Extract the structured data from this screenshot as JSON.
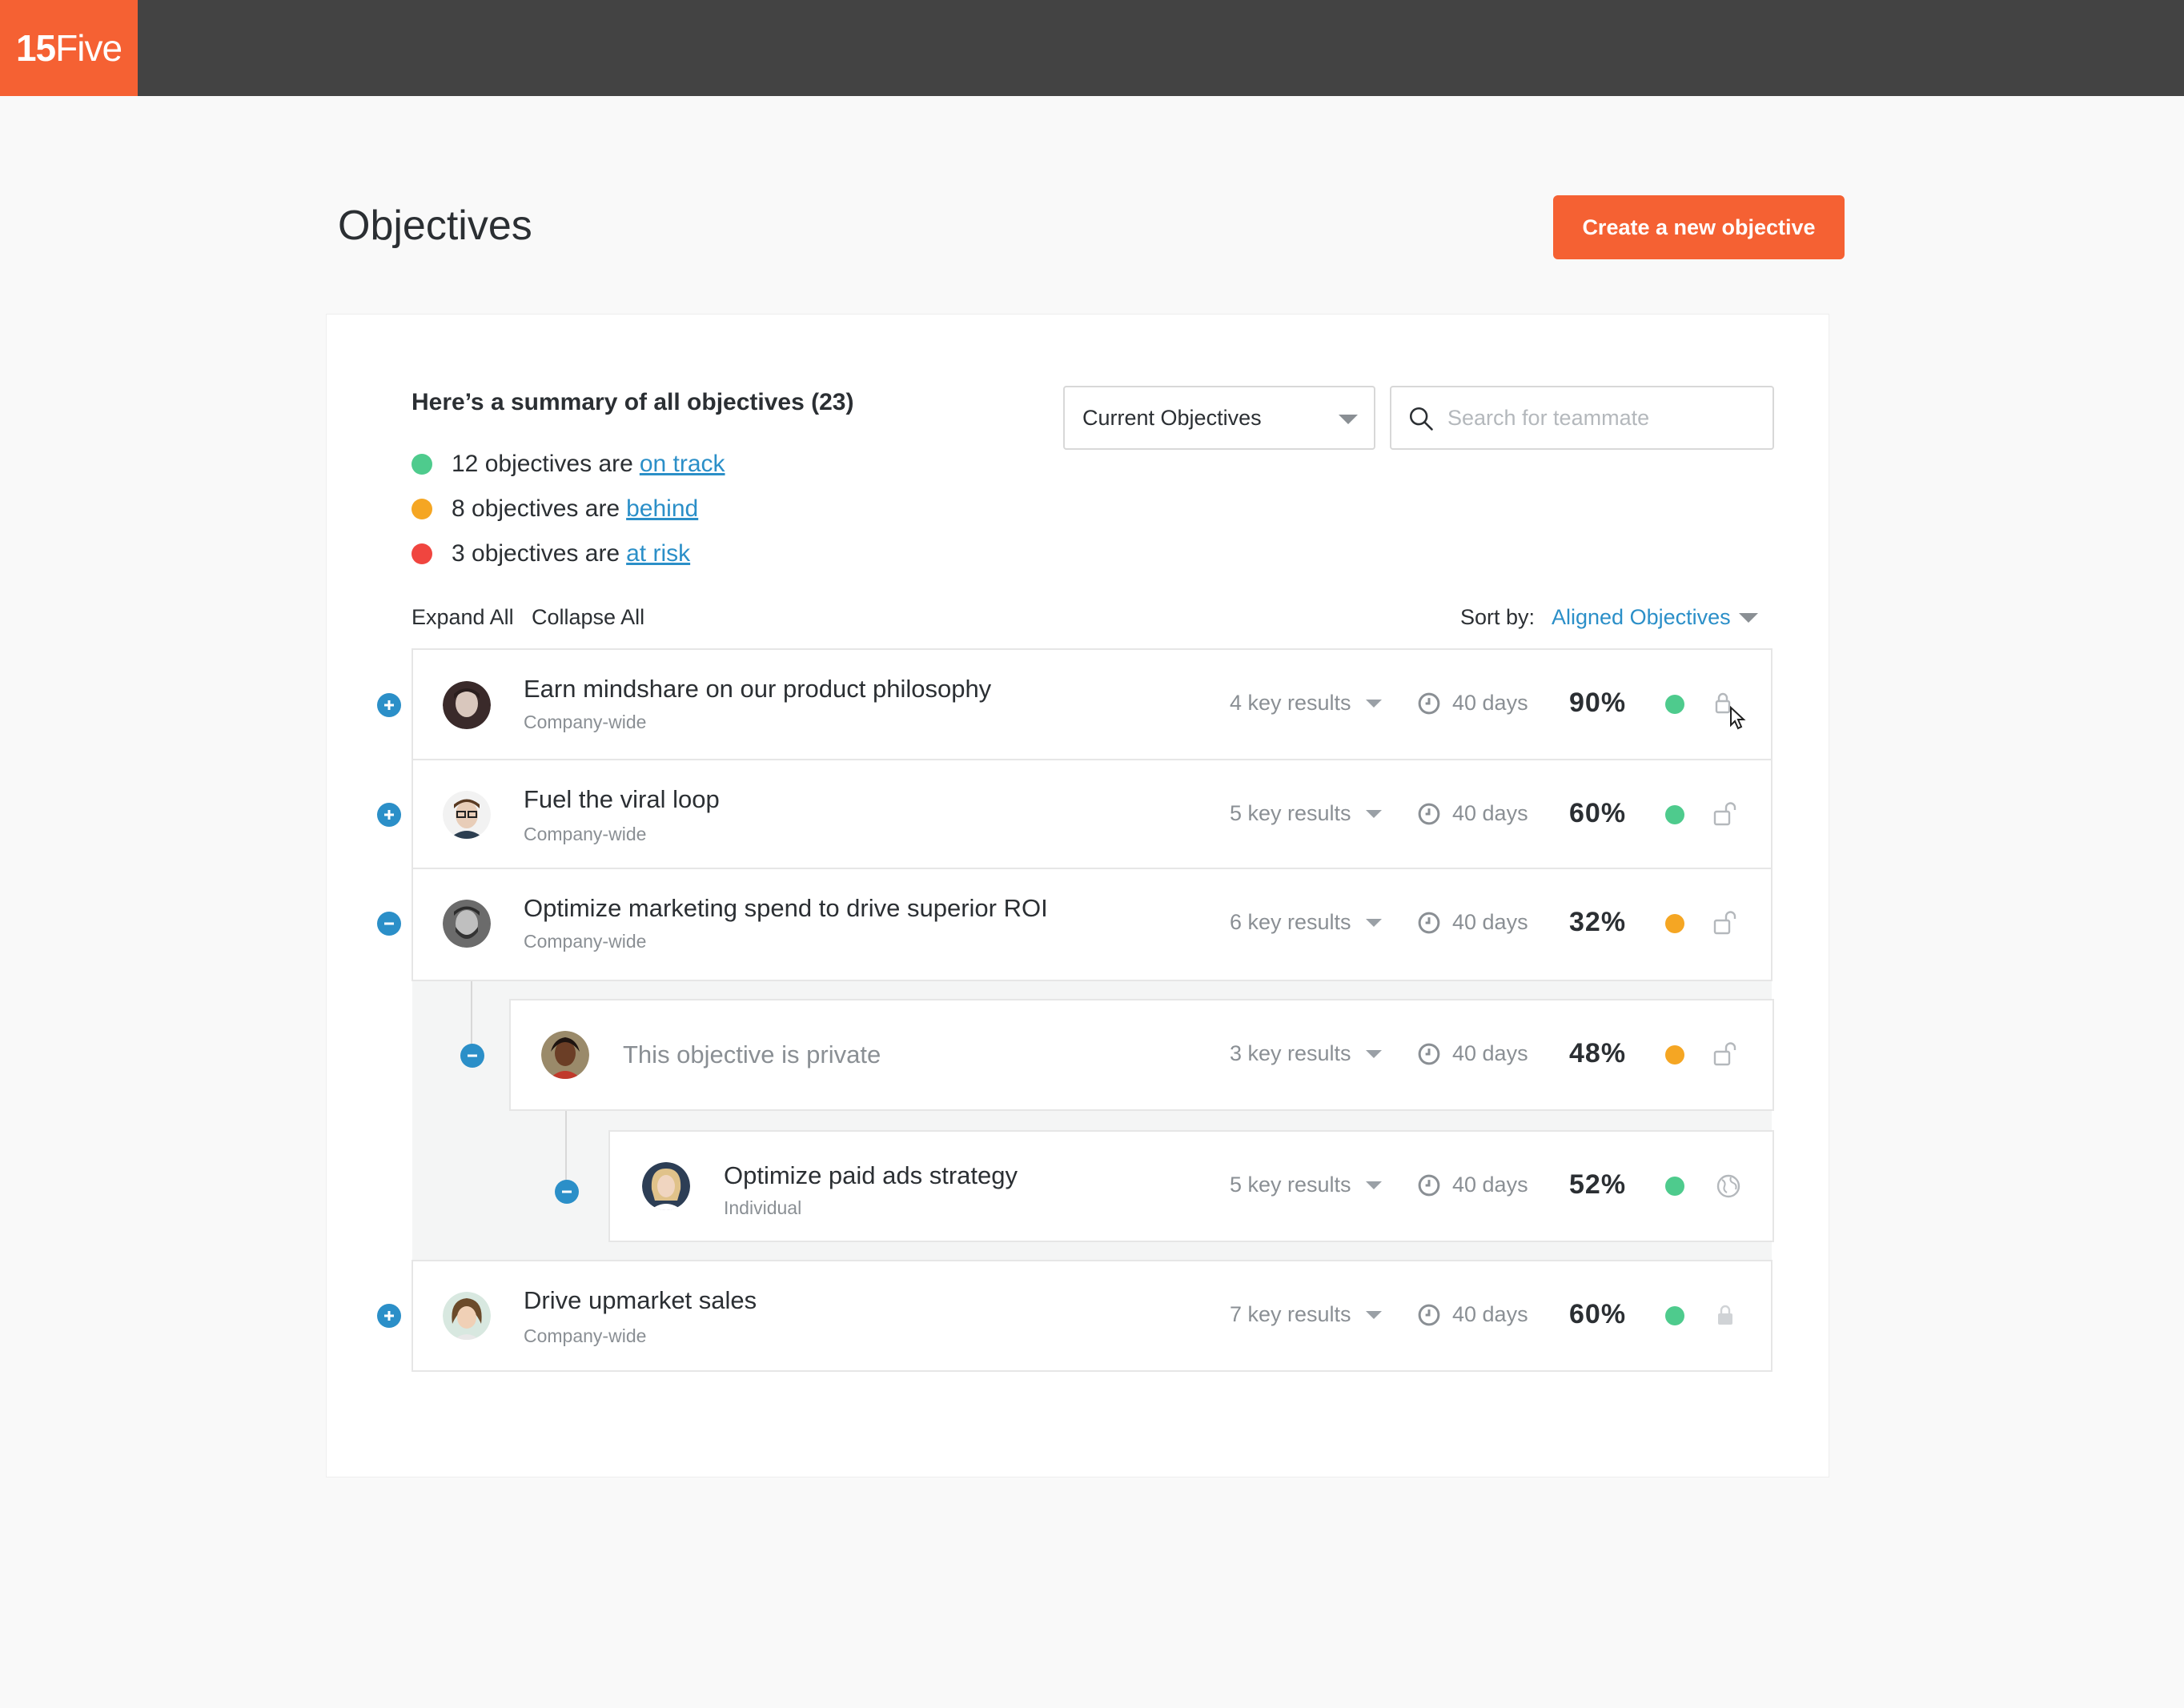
{
  "app": {
    "logo_bold": "15",
    "logo_light": "Five",
    "accent_color": "#f56133",
    "link_color": "#2b8fc8"
  },
  "header": {
    "title": "Objectives",
    "create_button": "Create a new objective"
  },
  "summary": {
    "title": "Here’s a summary of all objectives (23)",
    "lines": [
      {
        "prefix": "12 objectives are",
        "link": "on track",
        "color": "#4ecb8d"
      },
      {
        "prefix": "8 objectives are",
        "link": "behind",
        "color": "#f5a623"
      },
      {
        "prefix": "3 objectives are",
        "link": "at risk",
        "color": "#f0453f"
      }
    ]
  },
  "filters": {
    "period_selected": "Current Objectives",
    "search_placeholder": "Search for teammate"
  },
  "controls": {
    "expand_all": "Expand All",
    "collapse_all": "Collapse All",
    "sort_label": "Sort by:",
    "sort_value": "Aligned Objectives"
  },
  "objectives": [
    {
      "title": "Earn mindshare on our product philosophy",
      "scope": "Company-wide",
      "key_results": "4 key results",
      "days": "40 days",
      "progress": "90%",
      "status": "on track",
      "status_color": "#4ecb8d",
      "toggle": "expand",
      "icon": "lock-hover-icon"
    },
    {
      "title": "Fuel the viral loop",
      "scope": "Company-wide",
      "key_results": "5 key results",
      "days": "40 days",
      "progress": "60%",
      "status": "on track",
      "status_color": "#4ecb8d",
      "toggle": "expand",
      "icon": "unlock-icon"
    },
    {
      "title": "Optimize marketing spend to drive superior ROI",
      "scope": "Company-wide",
      "key_results": "6 key results",
      "days": "40 days",
      "progress": "32%",
      "status": "behind",
      "status_color": "#f5a623",
      "toggle": "collapse",
      "icon": "unlock-icon"
    },
    {
      "title": "This objective is private",
      "scope": "",
      "key_results": "3 key results",
      "days": "40 days",
      "progress": "48%",
      "status": "behind",
      "status_color": "#f5a623",
      "toggle": "collapse",
      "icon": "unlock-icon"
    },
    {
      "title": "Optimize paid ads strategy",
      "scope": "Individual",
      "key_results": "5 key results",
      "days": "40 days",
      "progress": "52%",
      "status": "on track",
      "status_color": "#4ecb8d",
      "toggle": "collapse",
      "icon": "globe-icon"
    },
    {
      "title": "Drive upmarket sales",
      "scope": "Company-wide",
      "key_results": "7 key results",
      "days": "40 days",
      "progress": "60%",
      "status": "on track",
      "status_color": "#4ecb8d",
      "toggle": "expand",
      "icon": "lock-icon"
    }
  ]
}
